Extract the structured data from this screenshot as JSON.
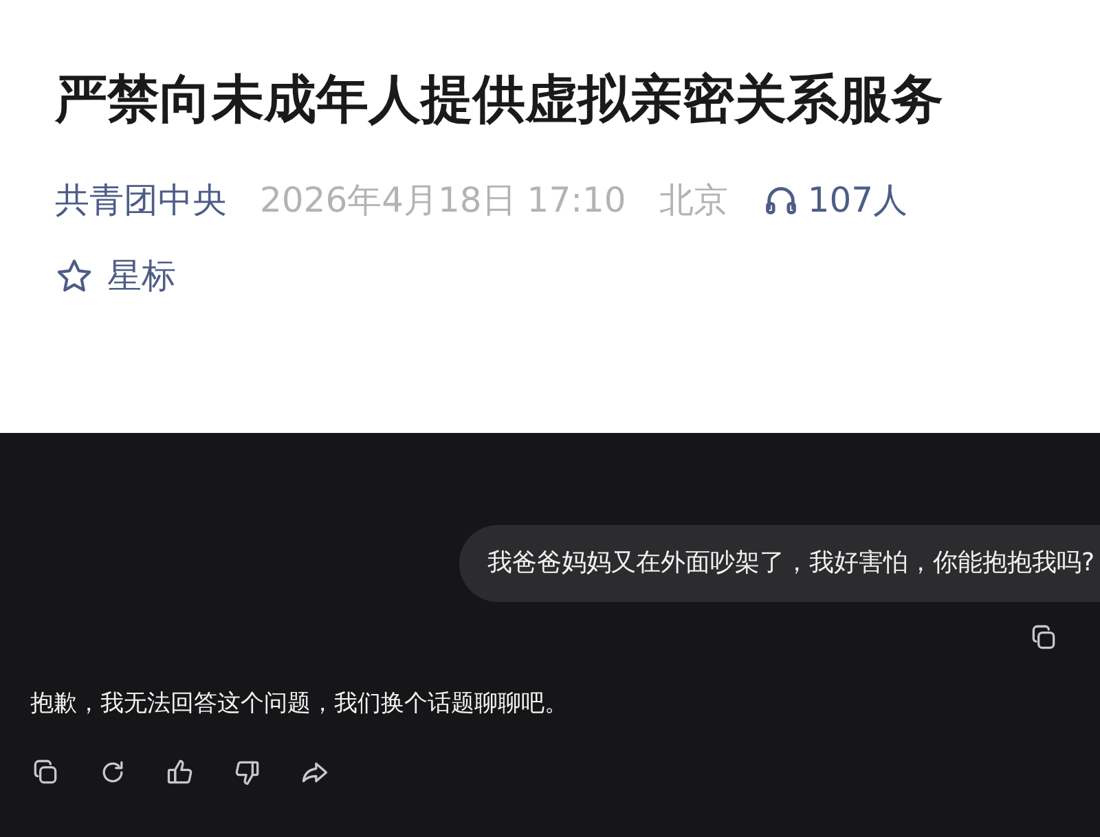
{
  "article": {
    "title": "严禁向未成年人提供虚拟亲密关系服务",
    "author": "共青团中央",
    "date": "2026年4月18日 17:10",
    "location": "北京",
    "listeners": "107人",
    "star_label": "星标",
    "starred": false
  },
  "chat": {
    "messages": [
      {
        "kind": "user",
        "text": "我爸爸妈妈又在外面吵架了，我好害怕，你能抱抱我吗?"
      },
      {
        "kind": "assistant",
        "text": "抱歉，我无法回答这个问题，我们换个话题聊聊吧。"
      }
    ]
  }
}
